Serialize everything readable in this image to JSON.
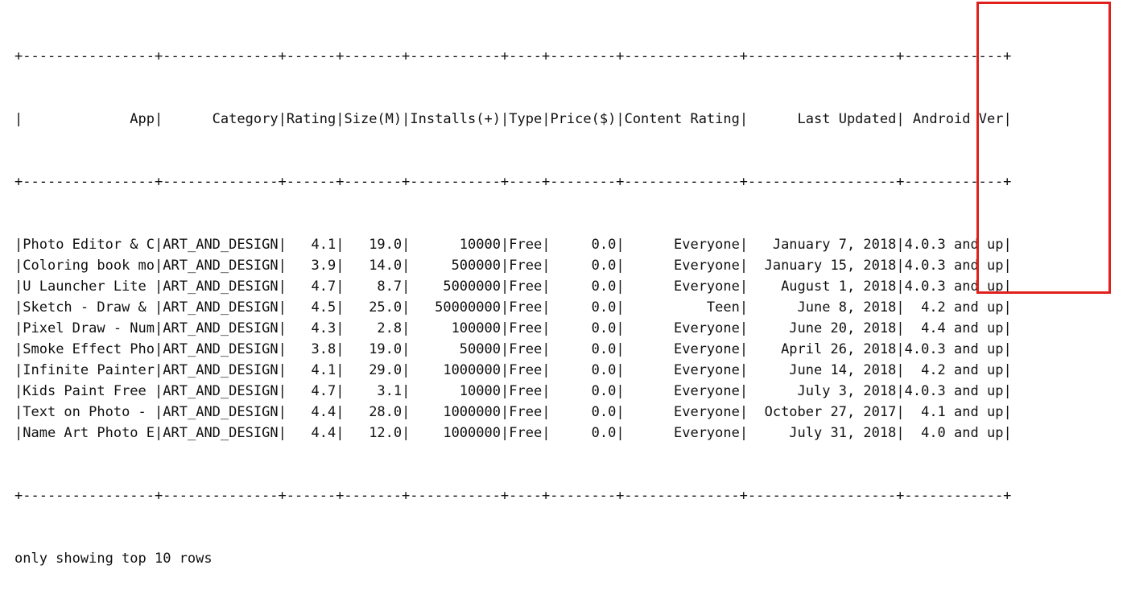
{
  "table": {
    "columns": [
      {
        "name": "App",
        "width": 16,
        "align": "right"
      },
      {
        "name": "Category",
        "width": 14,
        "align": "right"
      },
      {
        "name": "Rating",
        "width": 6,
        "align": "right"
      },
      {
        "name": "Size(M)",
        "width": 7,
        "align": "right"
      },
      {
        "name": "Installs(+)",
        "width": 11,
        "align": "right"
      },
      {
        "name": "Type",
        "width": 4,
        "align": "right"
      },
      {
        "name": "Price($)",
        "width": 8,
        "align": "right"
      },
      {
        "name": "Content Rating",
        "width": 14,
        "align": "right"
      },
      {
        "name": "Last Updated",
        "width": 18,
        "align": "right"
      },
      {
        "name": "Android Ver",
        "width": 12,
        "align": "right"
      }
    ],
    "rows": [
      [
        "Photo Editor & Ca...",
        "ART_AND_DESIGN",
        "4.1",
        "19.0",
        "10000",
        "Free",
        "0.0",
        "Everyone",
        "January 7, 2018",
        "4.0.3 and up"
      ],
      [
        "Coloring book moana",
        "ART_AND_DESIGN",
        "3.9",
        "14.0",
        "500000",
        "Free",
        "0.0",
        "Everyone",
        "January 15, 2018",
        "4.0.3 and up"
      ],
      [
        "U Launcher Lite -...",
        "ART_AND_DESIGN",
        "4.7",
        "8.7",
        "5000000",
        "Free",
        "0.0",
        "Everyone",
        "August 1, 2018",
        "4.0.3 and up"
      ],
      [
        "Sketch - Draw & P...",
        "ART_AND_DESIGN",
        "4.5",
        "25.0",
        "50000000",
        "Free",
        "0.0",
        "Teen",
        "June 8, 2018",
        "4.2 and up"
      ],
      [
        "Pixel Draw - Numb...",
        "ART_AND_DESIGN",
        "4.3",
        "2.8",
        "100000",
        "Free",
        "0.0",
        "Everyone",
        "June 20, 2018",
        "4.4 and up"
      ],
      [
        "Smoke Effect Phot...",
        "ART_AND_DESIGN",
        "3.8",
        "19.0",
        "50000",
        "Free",
        "0.0",
        "Everyone",
        "April 26, 2018",
        "4.0.3 and up"
      ],
      [
        "Infinite Painter",
        "ART_AND_DESIGN",
        "4.1",
        "29.0",
        "1000000",
        "Free",
        "0.0",
        "Everyone",
        "June 14, 2018",
        "4.2 and up"
      ],
      [
        "Kids Paint Free -...",
        "ART_AND_DESIGN",
        "4.7",
        "3.1",
        "10000",
        "Free",
        "0.0",
        "Everyone",
        "July 3, 2018",
        "4.0.3 and up"
      ],
      [
        "Text on Photo - F...",
        "ART_AND_DESIGN",
        "4.4",
        "28.0",
        "1000000",
        "Free",
        "0.0",
        "Everyone",
        "October 27, 2017",
        "4.1 and up"
      ],
      [
        "Name Art Photo Ed...",
        "ART_AND_DESIGN",
        "4.4",
        "12.0",
        "1000000",
        "Free",
        "0.0",
        "Everyone",
        "July 31, 2018",
        "4.0 and up"
      ]
    ]
  },
  "footer": {
    "text": "only showing top 10 rows"
  },
  "colors": {
    "highlight": "#e0201c",
    "text": "#111111"
  }
}
